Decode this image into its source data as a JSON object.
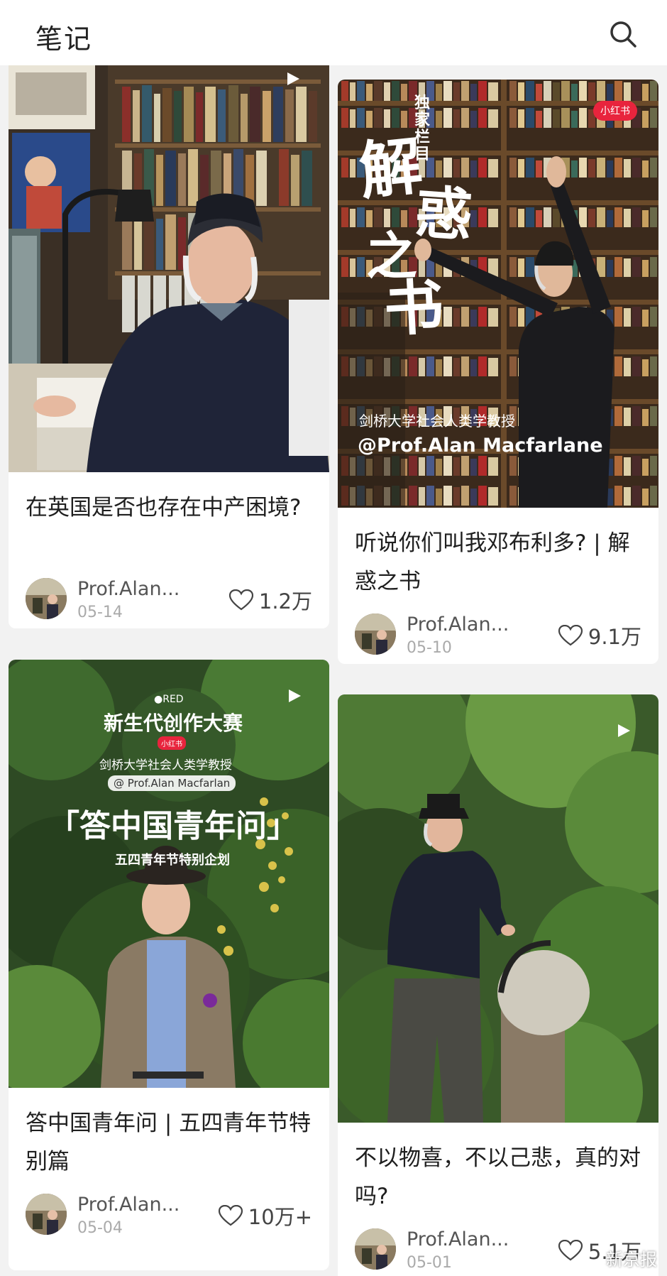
{
  "header": {
    "title": "笔记"
  },
  "cards": [
    {
      "title": "在英国是否也存在中产困境?",
      "author": "Prof.Alan...",
      "date": "05-14",
      "likes": "1.2万"
    },
    {
      "title": "听说你们叫我邓布利多? | 解惑之书",
      "author": "Prof.Alan...",
      "date": "05-10",
      "likes": "9.1万",
      "overlay": {
        "tag": "独家栏目",
        "big": [
          "解",
          "惑",
          "之",
          "书"
        ],
        "sub": "剑桥大学社会人类学教授",
        "handle": "@Prof.Alan Macfarlane",
        "brand": "小红书"
      }
    },
    {
      "title": "答中国青年问 | 五四青年节特别篇",
      "author": "Prof.Alan...",
      "date": "05-04",
      "likes": "10万+",
      "overlay": {
        "brand": "●RED",
        "contest": "新生代创作大赛",
        "badge": "小红书",
        "sub": "剑桥大学社会人类学教授",
        "handle": "@ Prof.Alan Macfarlan",
        "big": "「答中国青年问」",
        "small": "五四青年节特别企划"
      }
    },
    {
      "title": "不以物喜，不以己悲，真的对吗?",
      "author": "Prof.Alan...",
      "date": "05-01",
      "likes": "5.1万"
    }
  ],
  "watermark": "新京报",
  "colors": {
    "background": "#f2f2f2",
    "card": "#ffffff",
    "text": "#1f1f1f",
    "muted": "#aaaaaa"
  }
}
